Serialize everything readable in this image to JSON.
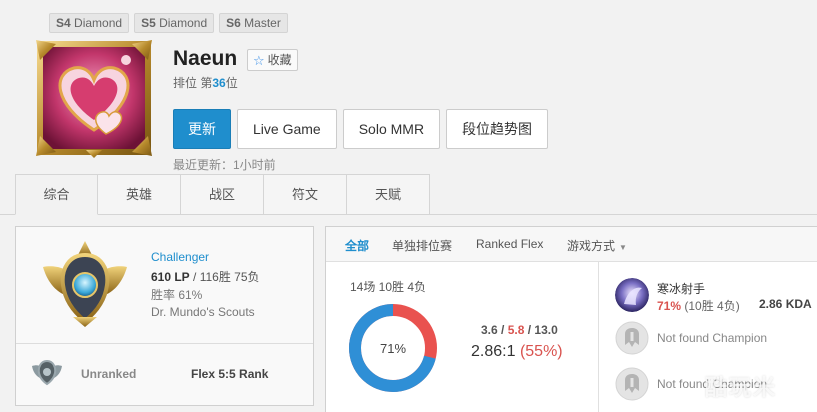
{
  "season_tags": [
    {
      "season": "S4",
      "tier": "Diamond"
    },
    {
      "season": "S5",
      "tier": "Diamond"
    },
    {
      "season": "S6",
      "tier": "Master"
    }
  ],
  "profile": {
    "name": "Naeun",
    "favorite_label": "收藏",
    "rank_prefix": "排位 第",
    "rank_number": "36",
    "rank_suffix": "位",
    "last_update": "最近更新：1小时前"
  },
  "actions": {
    "refresh": "更新",
    "live_game": "Live Game",
    "solo_mmr": "Solo MMR",
    "tier_graph": "段位趋势图"
  },
  "tabs": [
    "综合",
    "英雄",
    "战区",
    "符文",
    "天赋"
  ],
  "solo_rank": {
    "tier": "Challenger",
    "lp": "610 LP",
    "record": " / 116胜 75负",
    "winrate": "胜率 61%",
    "league": "Dr. Mundo's Scouts"
  },
  "flex_rank": {
    "status": "Unranked",
    "label": "Flex 5:5 Rank"
  },
  "filters": {
    "all": "全部",
    "solo": "单独排位赛",
    "flex": "Ranked Flex",
    "mode": "游戏方式"
  },
  "summary": {
    "games": "14场 10胜 4负",
    "winrate_label": "71%",
    "win_fraction": 0.71,
    "kills": "3.6",
    "deaths": "5.8",
    "assists": "13.0",
    "ratio": "2.86:1",
    "ratio_pct": "(55%)"
  },
  "champions": [
    {
      "name": "寒冰射手",
      "winrate": "71%",
      "record": "(10胜 4负)",
      "kda": "2.86 KDA"
    },
    {
      "not_found": "Not found Champion"
    },
    {
      "not_found": "Not found Champion"
    }
  ],
  "watermark": "酷玩米",
  "colors": {
    "accent": "#1f8ecd",
    "loss": "#e9524f",
    "win_ring": "#2f8fd6"
  }
}
